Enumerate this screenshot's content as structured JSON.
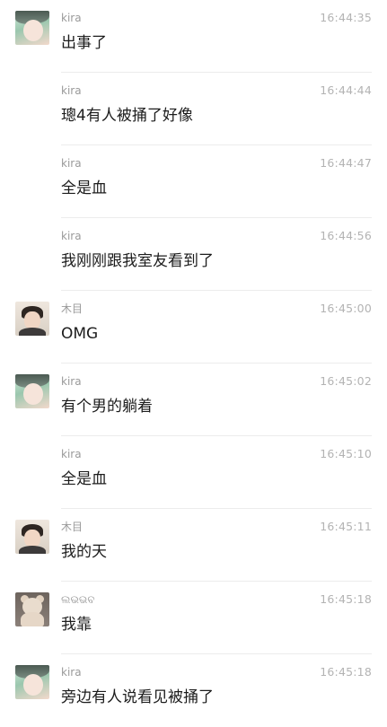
{
  "messages": [
    {
      "sender": "kira",
      "time": "16:44:35",
      "text": "出事了",
      "avatar": "kira-avatar"
    },
    {
      "sender": "kira",
      "time": "16:44:44",
      "text": "璁4有人被捅了好像",
      "avatar": ""
    },
    {
      "sender": "kira",
      "time": "16:44:47",
      "text": "全是血",
      "avatar": ""
    },
    {
      "sender": "kira",
      "time": "16:44:56",
      "text": "我刚刚跟我室友看到了",
      "avatar": ""
    },
    {
      "sender": "木目",
      "time": "16:45:00",
      "text": "OMG",
      "avatar": "mumu-avatar"
    },
    {
      "sender": "kira",
      "time": "16:45:02",
      "text": "有个男的躺着",
      "avatar": "kira-avatar"
    },
    {
      "sender": "kira",
      "time": "16:45:10",
      "text": "全是血",
      "avatar": ""
    },
    {
      "sender": "木目",
      "time": "16:45:11",
      "text": "我的天",
      "avatar": "mumu-avatar"
    },
    {
      "sender": "ଲଭଭବ",
      "time": "16:45:18",
      "text": "我靠",
      "avatar": "bear-avatar"
    },
    {
      "sender": "kira",
      "time": "16:45:18",
      "text": "旁边有人说看见被捅了",
      "avatar": "kira-avatar"
    }
  ]
}
